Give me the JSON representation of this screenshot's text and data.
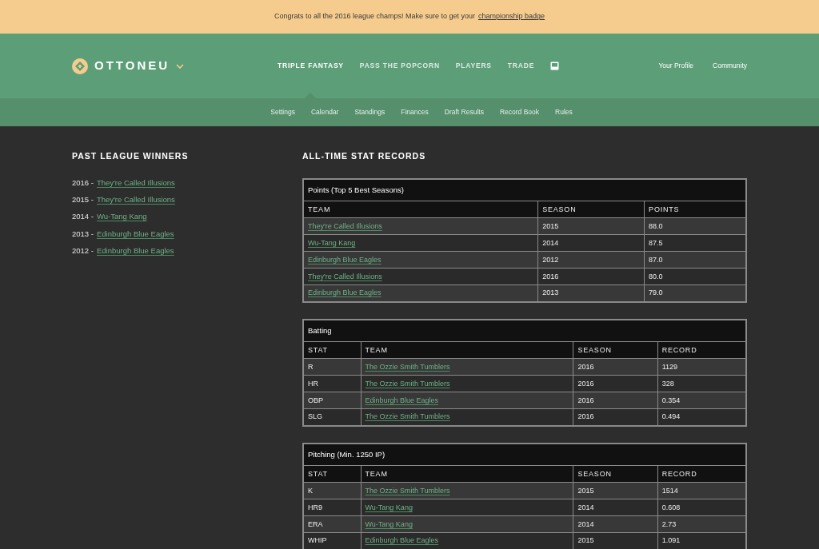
{
  "banner": {
    "message": "Congrats to all the 2016 league champs! Make sure to get your",
    "link": "championship badge"
  },
  "header": {
    "logo": "OTTONEU",
    "main_tabs": [
      {
        "label": "TRIPLE FANTASY",
        "selected": true
      },
      {
        "label": "PASS THE POPCORN",
        "selected": false
      },
      {
        "label": "PLAYERS",
        "selected": false
      },
      {
        "label": "TRADE",
        "selected": false
      }
    ],
    "user_links": [
      "Your Profile",
      "Community"
    ]
  },
  "subnav": [
    "Settings",
    "Calendar",
    "Standings",
    "Finances",
    "Draft Results",
    "Record Book",
    "Rules"
  ],
  "winners": {
    "title": "PAST LEAGUE WINNERS",
    "items": [
      {
        "prefix": "2016 -",
        "team": "They're Called Illusions"
      },
      {
        "prefix": "2015 -",
        "team": "They're Called Illusions"
      },
      {
        "prefix": "2014 -",
        "team": "Wu-Tang Kang"
      },
      {
        "prefix": "2013 -",
        "team": "Edinburgh Blue Eagles"
      },
      {
        "prefix": "2012 -",
        "team": "Edinburgh Blue Eagles"
      }
    ]
  },
  "records": {
    "title": "ALL-TIME STAT RECORDS",
    "tables": [
      {
        "title": "Points (Top 5 Best Seasons)",
        "columns": [
          {
            "label": "TEAM",
            "kind": "link"
          },
          {
            "label": "SEASON",
            "kind": "text"
          },
          {
            "label": "POINTS",
            "kind": "text"
          }
        ],
        "rows": [
          [
            "They're Called Illusions",
            "2015",
            "88.0"
          ],
          [
            "Wu-Tang Kang",
            "2014",
            "87.5"
          ],
          [
            "Edinburgh Blue Eagles",
            "2012",
            "87.0"
          ],
          [
            "They're Called Illusions",
            "2016",
            "80.0"
          ],
          [
            "Edinburgh Blue Eagles",
            "2013",
            "79.0"
          ]
        ]
      },
      {
        "title": "Batting",
        "columns": [
          {
            "label": "STAT",
            "kind": "text"
          },
          {
            "label": "TEAM",
            "kind": "link"
          },
          {
            "label": "SEASON",
            "kind": "text"
          },
          {
            "label": "RECORD",
            "kind": "text"
          }
        ],
        "rows": [
          [
            "R",
            "The Ozzie Smith Tumblers",
            "2016",
            "1129"
          ],
          [
            "HR",
            "The Ozzie Smith Tumblers",
            "2016",
            "328"
          ],
          [
            "OBP",
            "Edinburgh Blue Eagles",
            "2016",
            "0.354"
          ],
          [
            "SLG",
            "The Ozzie Smith Tumblers",
            "2016",
            "0.494"
          ]
        ]
      },
      {
        "title": "Pitching (Min. 1250 IP)",
        "columns": [
          {
            "label": "STAT",
            "kind": "text"
          },
          {
            "label": "TEAM",
            "kind": "link"
          },
          {
            "label": "SEASON",
            "kind": "text"
          },
          {
            "label": "RECORD",
            "kind": "text"
          }
        ],
        "rows": [
          [
            "K",
            "The Ozzie Smith Tumblers",
            "2015",
            "1514"
          ],
          [
            "HR9",
            "Wu-Tang Kang",
            "2014",
            "0.608"
          ],
          [
            "ERA",
            "Wu-Tang Kang",
            "2014",
            "2.73"
          ],
          [
            "WHIP",
            "Edinburgh Blue Eagles",
            "2015",
            "1.091"
          ]
        ]
      }
    ]
  }
}
